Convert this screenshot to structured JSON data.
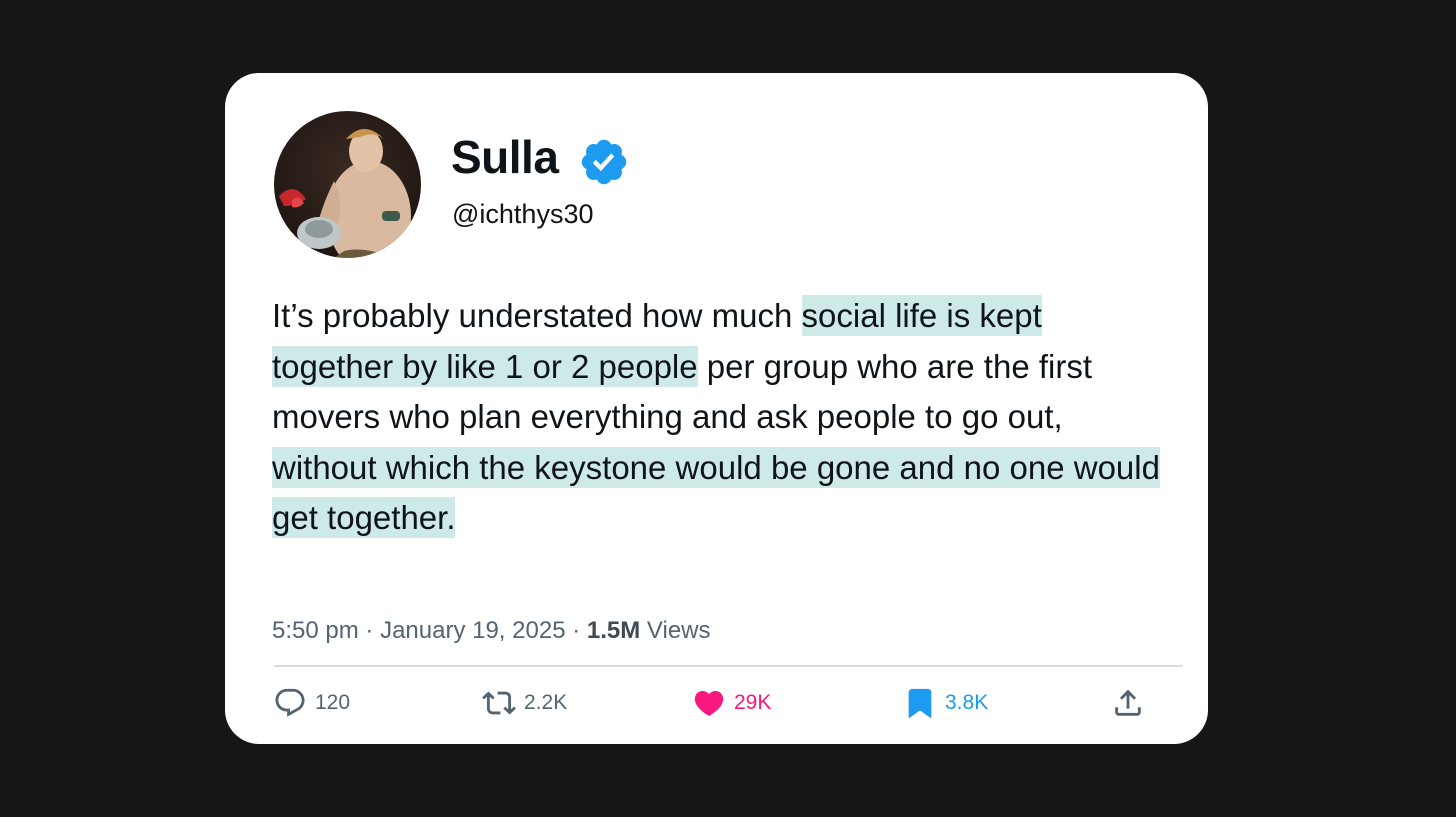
{
  "tweet": {
    "author": {
      "name": "Sulla",
      "handle": "@ichthys30",
      "verified_icon": "verified-badge-icon",
      "avatar": "painted-portrait-avatar"
    },
    "text": {
      "segments": [
        {
          "text": "It’s probably understated how much ",
          "highlight": false
        },
        {
          "text": "social life is kept together by like 1 or 2 people",
          "highlight": true
        },
        {
          "text": " per group who are the first movers who plan everything and ask people to go out, ",
          "highlight": false
        },
        {
          "text": "without which the keystone would be gone and no one would get together.",
          "highlight": true
        }
      ]
    },
    "meta": {
      "time": "5:50 pm",
      "separator": "·",
      "date": "January 19, 2025",
      "views_count": "1.5M",
      "views_label": "Views"
    },
    "actions": {
      "reply": {
        "icon": "reply-icon",
        "count": "120"
      },
      "retweet": {
        "icon": "retweet-icon",
        "count": "2.2K"
      },
      "like": {
        "icon": "heart-icon",
        "count": "29K"
      },
      "bookmark": {
        "icon": "bookmark-icon",
        "count": "3.8K"
      },
      "share": {
        "icon": "share-icon"
      }
    }
  },
  "colors": {
    "background": "#161616",
    "card": "#ffffff",
    "highlight": "#cdeae8",
    "verified": "#1d9bf0",
    "like": "#f91880",
    "bookmark": "#1d9bf0",
    "muted": "#536471"
  }
}
